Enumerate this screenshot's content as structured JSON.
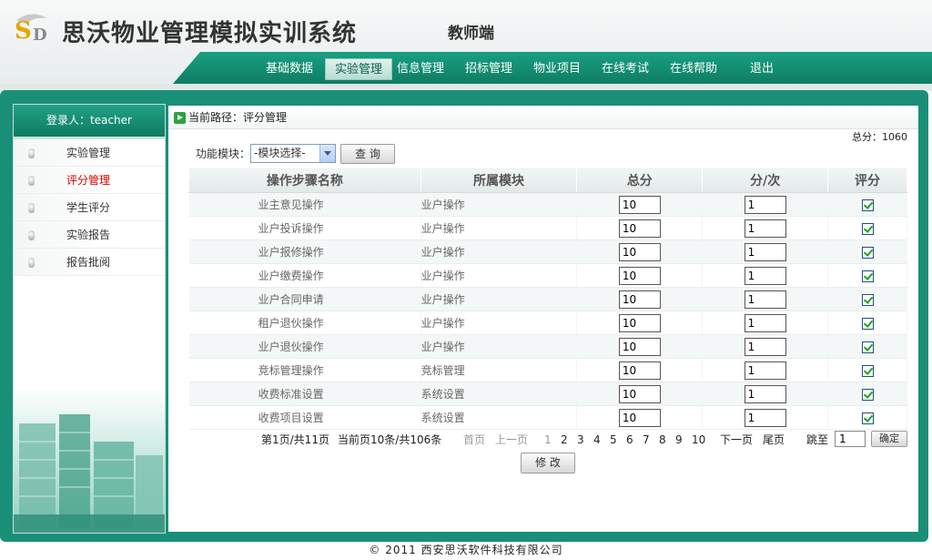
{
  "header": {
    "app_title": "思沃物业管理模拟实训系统",
    "role_label": "教师端"
  },
  "nav": [
    {
      "label": "基础数据",
      "active": false
    },
    {
      "label": "实验管理",
      "active": true
    },
    {
      "label": "信息管理",
      "active": false
    },
    {
      "label": "招标管理",
      "active": false
    },
    {
      "label": "物业项目",
      "active": false
    },
    {
      "label": "在线考试",
      "active": false
    },
    {
      "label": "在线帮助",
      "active": false
    },
    {
      "label": "退出",
      "active": false
    }
  ],
  "sidebar": {
    "login_label": "登录人：teacher",
    "items": [
      {
        "label": "实验管理",
        "active": false
      },
      {
        "label": "评分管理",
        "active": true
      },
      {
        "label": "学生评分",
        "active": false
      },
      {
        "label": "实验报告",
        "active": false
      },
      {
        "label": "报告批阅",
        "active": false
      }
    ]
  },
  "breadcrumb": "当前路径：评分管理",
  "total_score": "总分：1060",
  "filter": {
    "label": "功能模块：",
    "select_value": "-模块选择-",
    "query_button": "查 询"
  },
  "table": {
    "headers": [
      "操作步骤名称",
      "所属模块",
      "总分",
      "分/次",
      "评分"
    ],
    "rows": [
      {
        "name": "业主意见操作",
        "module": "业户操作",
        "total": "10",
        "per": "1",
        "checked": true
      },
      {
        "name": "业户投诉操作",
        "module": "业户操作",
        "total": "10",
        "per": "1",
        "checked": true
      },
      {
        "name": "业户报修操作",
        "module": "业户操作",
        "total": "10",
        "per": "1",
        "checked": true
      },
      {
        "name": "业户缴费操作",
        "module": "业户操作",
        "total": "10",
        "per": "1",
        "checked": true
      },
      {
        "name": "业户合同申请",
        "module": "业户操作",
        "total": "10",
        "per": "1",
        "checked": true
      },
      {
        "name": "租户退伙操作",
        "module": "业户操作",
        "total": "10",
        "per": "1",
        "checked": true
      },
      {
        "name": "业户退伙操作",
        "module": "业户操作",
        "total": "10",
        "per": "1",
        "checked": true
      },
      {
        "name": "竞标管理操作",
        "module": "竞标管理",
        "total": "10",
        "per": "1",
        "checked": true
      },
      {
        "name": "收费标准设置",
        "module": "系统设置",
        "total": "10",
        "per": "1",
        "checked": true
      },
      {
        "name": "收费项目设置",
        "module": "系统设置",
        "total": "10",
        "per": "1",
        "checked": true
      }
    ]
  },
  "pager": {
    "page_info": "第1页/共11页",
    "count_info": "当前页10条/共106条",
    "first": "首页",
    "prev": "上一页",
    "pages": [
      "1",
      "2",
      "3",
      "4",
      "5",
      "6",
      "7",
      "8",
      "9",
      "10"
    ],
    "current_page": "1",
    "next": "下一页",
    "last": "尾页",
    "jump_label": "跳至",
    "jump_value": "1",
    "confirm": "确定"
  },
  "modify_button": "修 改",
  "footer": "© 2011 西安思沃软件科技有限公司",
  "colors": {
    "brand_green": "#1a8f78",
    "active_red": "#d60000"
  }
}
